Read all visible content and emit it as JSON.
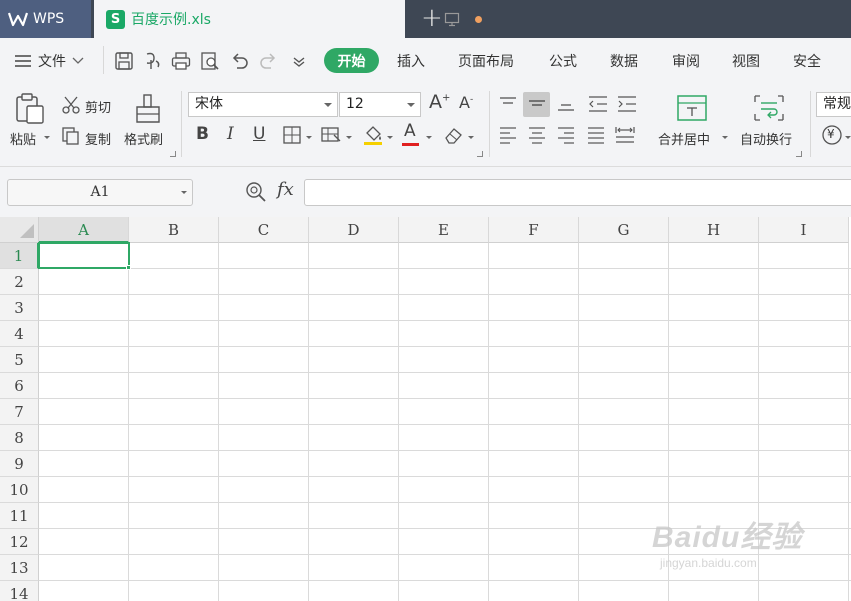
{
  "titlebar": {
    "app_name": "WPS",
    "document_tab": "百度示例.xls",
    "doc_icon_letter": "S"
  },
  "menu": {
    "file_label": "文件",
    "tabs": [
      "开始",
      "插入",
      "页面布局",
      "公式",
      "数据",
      "审阅",
      "视图",
      "安全"
    ],
    "active_tab": "开始"
  },
  "ribbon": {
    "paste_label": "粘贴",
    "cut_label": "剪切",
    "copy_label": "复制",
    "format_painter_label": "格式刷",
    "font_name": "宋体",
    "font_size": "12",
    "bold": "B",
    "italic": "I",
    "underline": "U",
    "merge_center_label": "合并居中",
    "wrap_text_label": "自动换行",
    "number_format": "常规",
    "currency_symbol": "¥"
  },
  "formula_bar": {
    "name_box": "A1",
    "fx_label": "fx",
    "formula_value": ""
  },
  "grid": {
    "columns": [
      "A",
      "B",
      "C",
      "D",
      "E",
      "F",
      "G",
      "H",
      "I"
    ],
    "rows": [
      "1",
      "2",
      "3",
      "4",
      "5",
      "6",
      "7",
      "8",
      "9",
      "10",
      "11",
      "12",
      "13",
      "14"
    ],
    "selected_column": "A",
    "selected_row": "1"
  },
  "watermark": {
    "brand": "Baidu经验",
    "url": "jingyan.baidu.com"
  },
  "colors": {
    "accent_green": "#2fa865",
    "titlebar_dark": "#3e4754",
    "wps_tab": "#4e5f80",
    "font_color_underline": "#e02020",
    "highlight_underline": "#f5d000"
  }
}
